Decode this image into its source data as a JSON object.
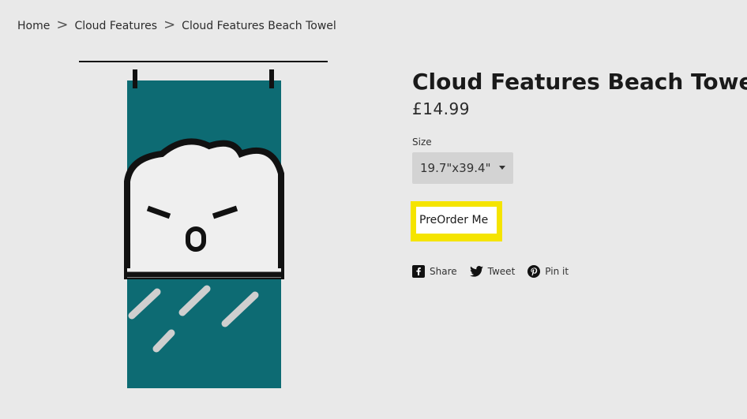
{
  "breadcrumb": {
    "items": [
      "Home",
      "Cloud Features",
      "Cloud Features Beach Towel"
    ]
  },
  "product": {
    "title": "Cloud Features Beach Towel",
    "price": "£14.99",
    "size_label": "Size",
    "size_value": "19.7\"x39.4\"",
    "preorder_label": "PreOrder Me"
  },
  "social": {
    "share": "Share",
    "tweet": "Tweet",
    "pin": "Pin it"
  },
  "icons": {
    "share": "facebook-icon",
    "tweet": "twitter-icon",
    "pin": "pinterest-icon",
    "caret": "chevron-down-icon"
  },
  "colors": {
    "background": "#e9e9e9",
    "highlight": "#f5e400",
    "towel_teal": "#0d6b73",
    "towel_band": "#efefef"
  }
}
